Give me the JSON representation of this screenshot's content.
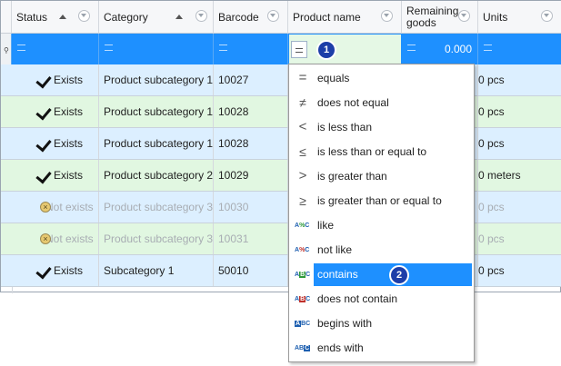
{
  "columns": [
    {
      "label": "Status"
    },
    {
      "label": "Category"
    },
    {
      "label": "Barcode"
    },
    {
      "label": "Product name"
    },
    {
      "label": "Remaining goods"
    },
    {
      "label": "Units"
    }
  ],
  "filter_row": {
    "product_name_marker": "1",
    "remaining_value": "0.000"
  },
  "rows": [
    {
      "status": "Exists",
      "category": "Product subcategory 1",
      "barcode": "10027",
      "units": "0 pcs",
      "exists": true
    },
    {
      "status": "Exists",
      "category": "Product subcategory 1",
      "barcode": "10028",
      "units": "0 pcs",
      "exists": true
    },
    {
      "status": "Exists",
      "category": "Product subcategory 1",
      "barcode": "10028",
      "units": "0 pcs",
      "exists": true
    },
    {
      "status": "Exists",
      "category": "Product subcategory 2",
      "barcode": "10029",
      "units": "0 meters",
      "exists": true
    },
    {
      "status": "Not exists",
      "category": "Product subcategory 3",
      "barcode": "10030",
      "units": "0 pcs",
      "exists": false
    },
    {
      "status": "Not exists",
      "category": "Product subcategory 3",
      "barcode": "10031",
      "units": "0 pcs",
      "exists": false
    },
    {
      "status": "Exists",
      "category": "Subcategory 1",
      "barcode": "50010",
      "units": "0 pcs",
      "exists": true
    }
  ],
  "menu": {
    "items": [
      {
        "label": "equals",
        "icon": "equals-icon"
      },
      {
        "label": "does not equal",
        "icon": "not-equal-icon"
      },
      {
        "label": "is less than",
        "icon": "less-than-icon"
      },
      {
        "label": "is less than or equal to",
        "icon": "less-equal-icon"
      },
      {
        "label": "is greater than",
        "icon": "greater-than-icon"
      },
      {
        "label": "is greater than or equal to",
        "icon": "greater-equal-icon"
      },
      {
        "label": "like",
        "icon": "like-icon"
      },
      {
        "label": "not like",
        "icon": "not-like-icon"
      },
      {
        "label": "contains",
        "icon": "contains-icon"
      },
      {
        "label": "does not contain",
        "icon": "does-not-contain-icon"
      },
      {
        "label": "begins with",
        "icon": "begins-with-icon"
      },
      {
        "label": "ends with",
        "icon": "ends-with-icon"
      }
    ],
    "selected_index": 8,
    "selected_marker": "2"
  },
  "icon_glyphs": {
    "like": "A%C",
    "not_like": "A%C",
    "abc": "ABC"
  },
  "colors": {
    "selection": "#1e90ff",
    "row_blue": "#dcefff",
    "row_green": "#e1f7e1",
    "badge": "#1d3ea8"
  }
}
